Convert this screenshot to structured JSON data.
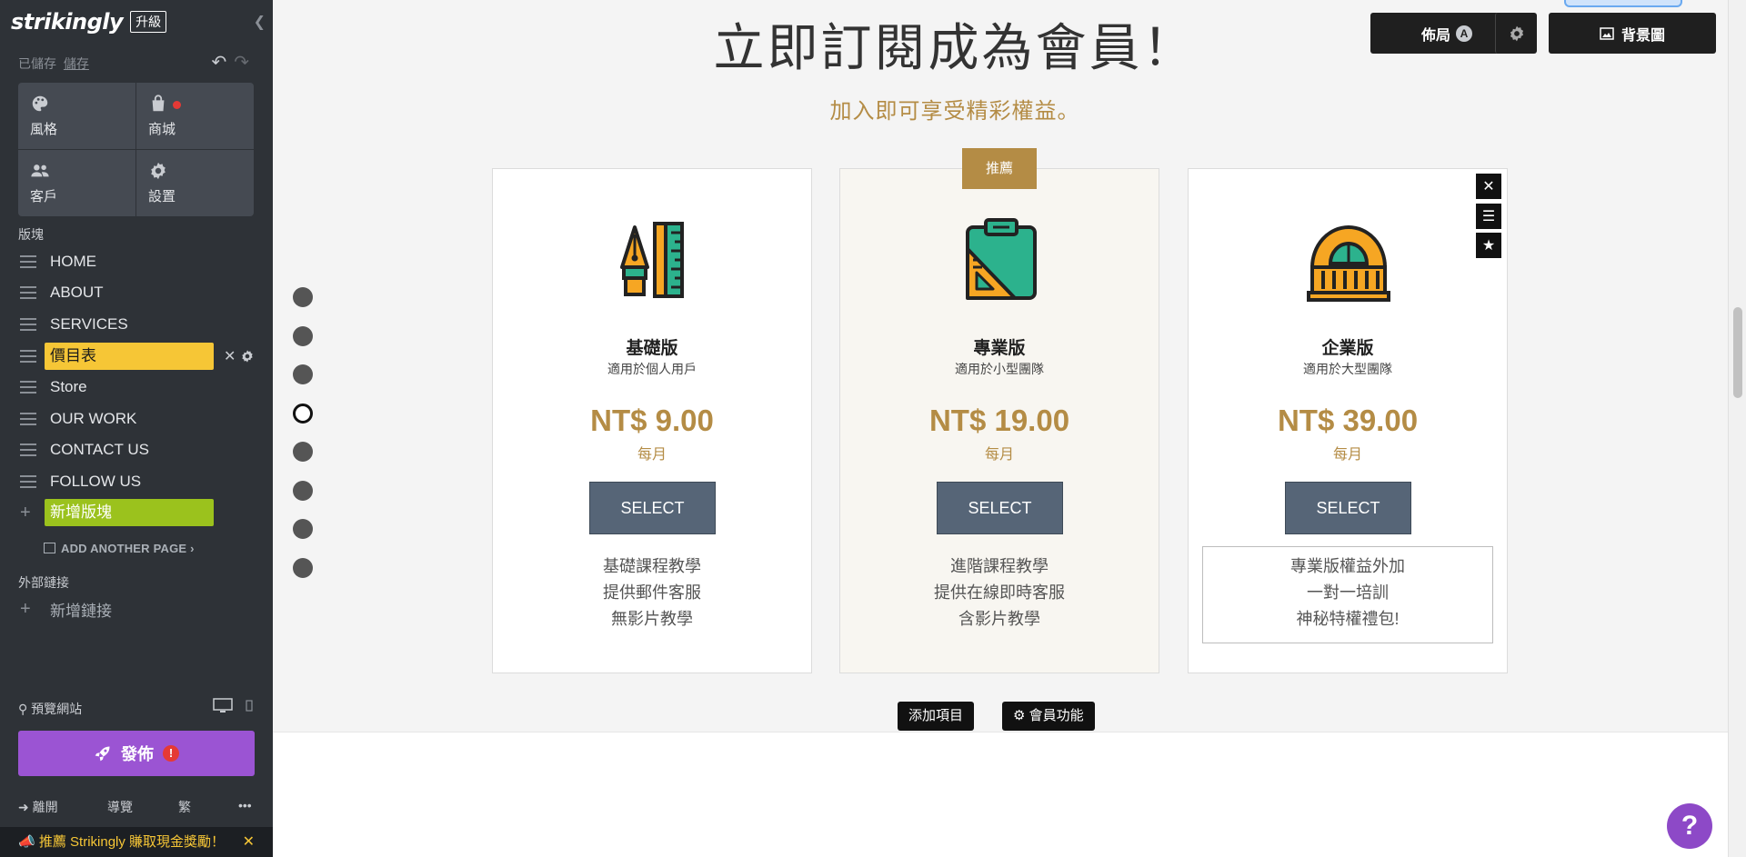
{
  "sidebar": {
    "logo": "strikingly",
    "upgrade": "升級",
    "saved_status": "已儲存",
    "save_link": "儲存",
    "tiles": [
      {
        "label": "風格",
        "icon": "palette-icon"
      },
      {
        "label": "商城",
        "icon": "shopping-bag-icon"
      },
      {
        "label": "客戶",
        "icon": "people-icon"
      },
      {
        "label": "設置",
        "icon": "gear-icon"
      }
    ],
    "sections_label": "版塊",
    "nav_items": [
      "HOME",
      "ABOUT",
      "SERVICES",
      "價目表",
      "Store",
      "OUR WORK",
      "CONTACT US",
      "FOLLOW US"
    ],
    "add_section": "新增版塊",
    "add_page": "ADD ANOTHER PAGE",
    "external_links_label": "外部鏈接",
    "add_link": "新增鏈接",
    "preview": "預覽網站",
    "publish": "發佈",
    "bottom": {
      "leave": "離開",
      "guide": "導覽",
      "lang": "繁",
      "more": "•••"
    },
    "promo": "推薦 Strikingly 賺取現金獎勵！"
  },
  "main": {
    "heading": "立即訂閱成為會員！",
    "subheading": "加入即可享受精彩權益。",
    "layout_button": "佈局",
    "layout_badge": "A",
    "background_button": "背景圖",
    "badge_recommended": "推薦",
    "plans": [
      {
        "name": "基礎版",
        "desc": "適用於個人用戶",
        "price": "NT$ 9.00",
        "period": "每月",
        "cta": "SELECT",
        "features": [
          "基礎課程教學",
          "提供郵件客服",
          "無影片教學"
        ]
      },
      {
        "name": "專業版",
        "desc": "適用於小型團隊",
        "price": "NT$ 19.00",
        "period": "每月",
        "cta": "SELECT",
        "features": [
          "進階課程教學",
          "提供在線即時客服",
          "含影片教學"
        ]
      },
      {
        "name": "企業版",
        "desc": "適用於大型團隊",
        "price": "NT$ 39.00",
        "period": "每月",
        "cta": "SELECT",
        "features": [
          "專業版權益外加",
          "一對一培訓",
          "神秘特權禮包!"
        ]
      }
    ],
    "add_item": "添加項目",
    "member_features": "會員功能",
    "help": "?"
  },
  "colors": {
    "accent_gold": "#b48c45",
    "sidebar_bg": "#2e3237",
    "active_yellow": "#f6c636",
    "add_green": "#9bc21d",
    "publish_purple": "#9b54d3",
    "select_slate": "#566577"
  }
}
